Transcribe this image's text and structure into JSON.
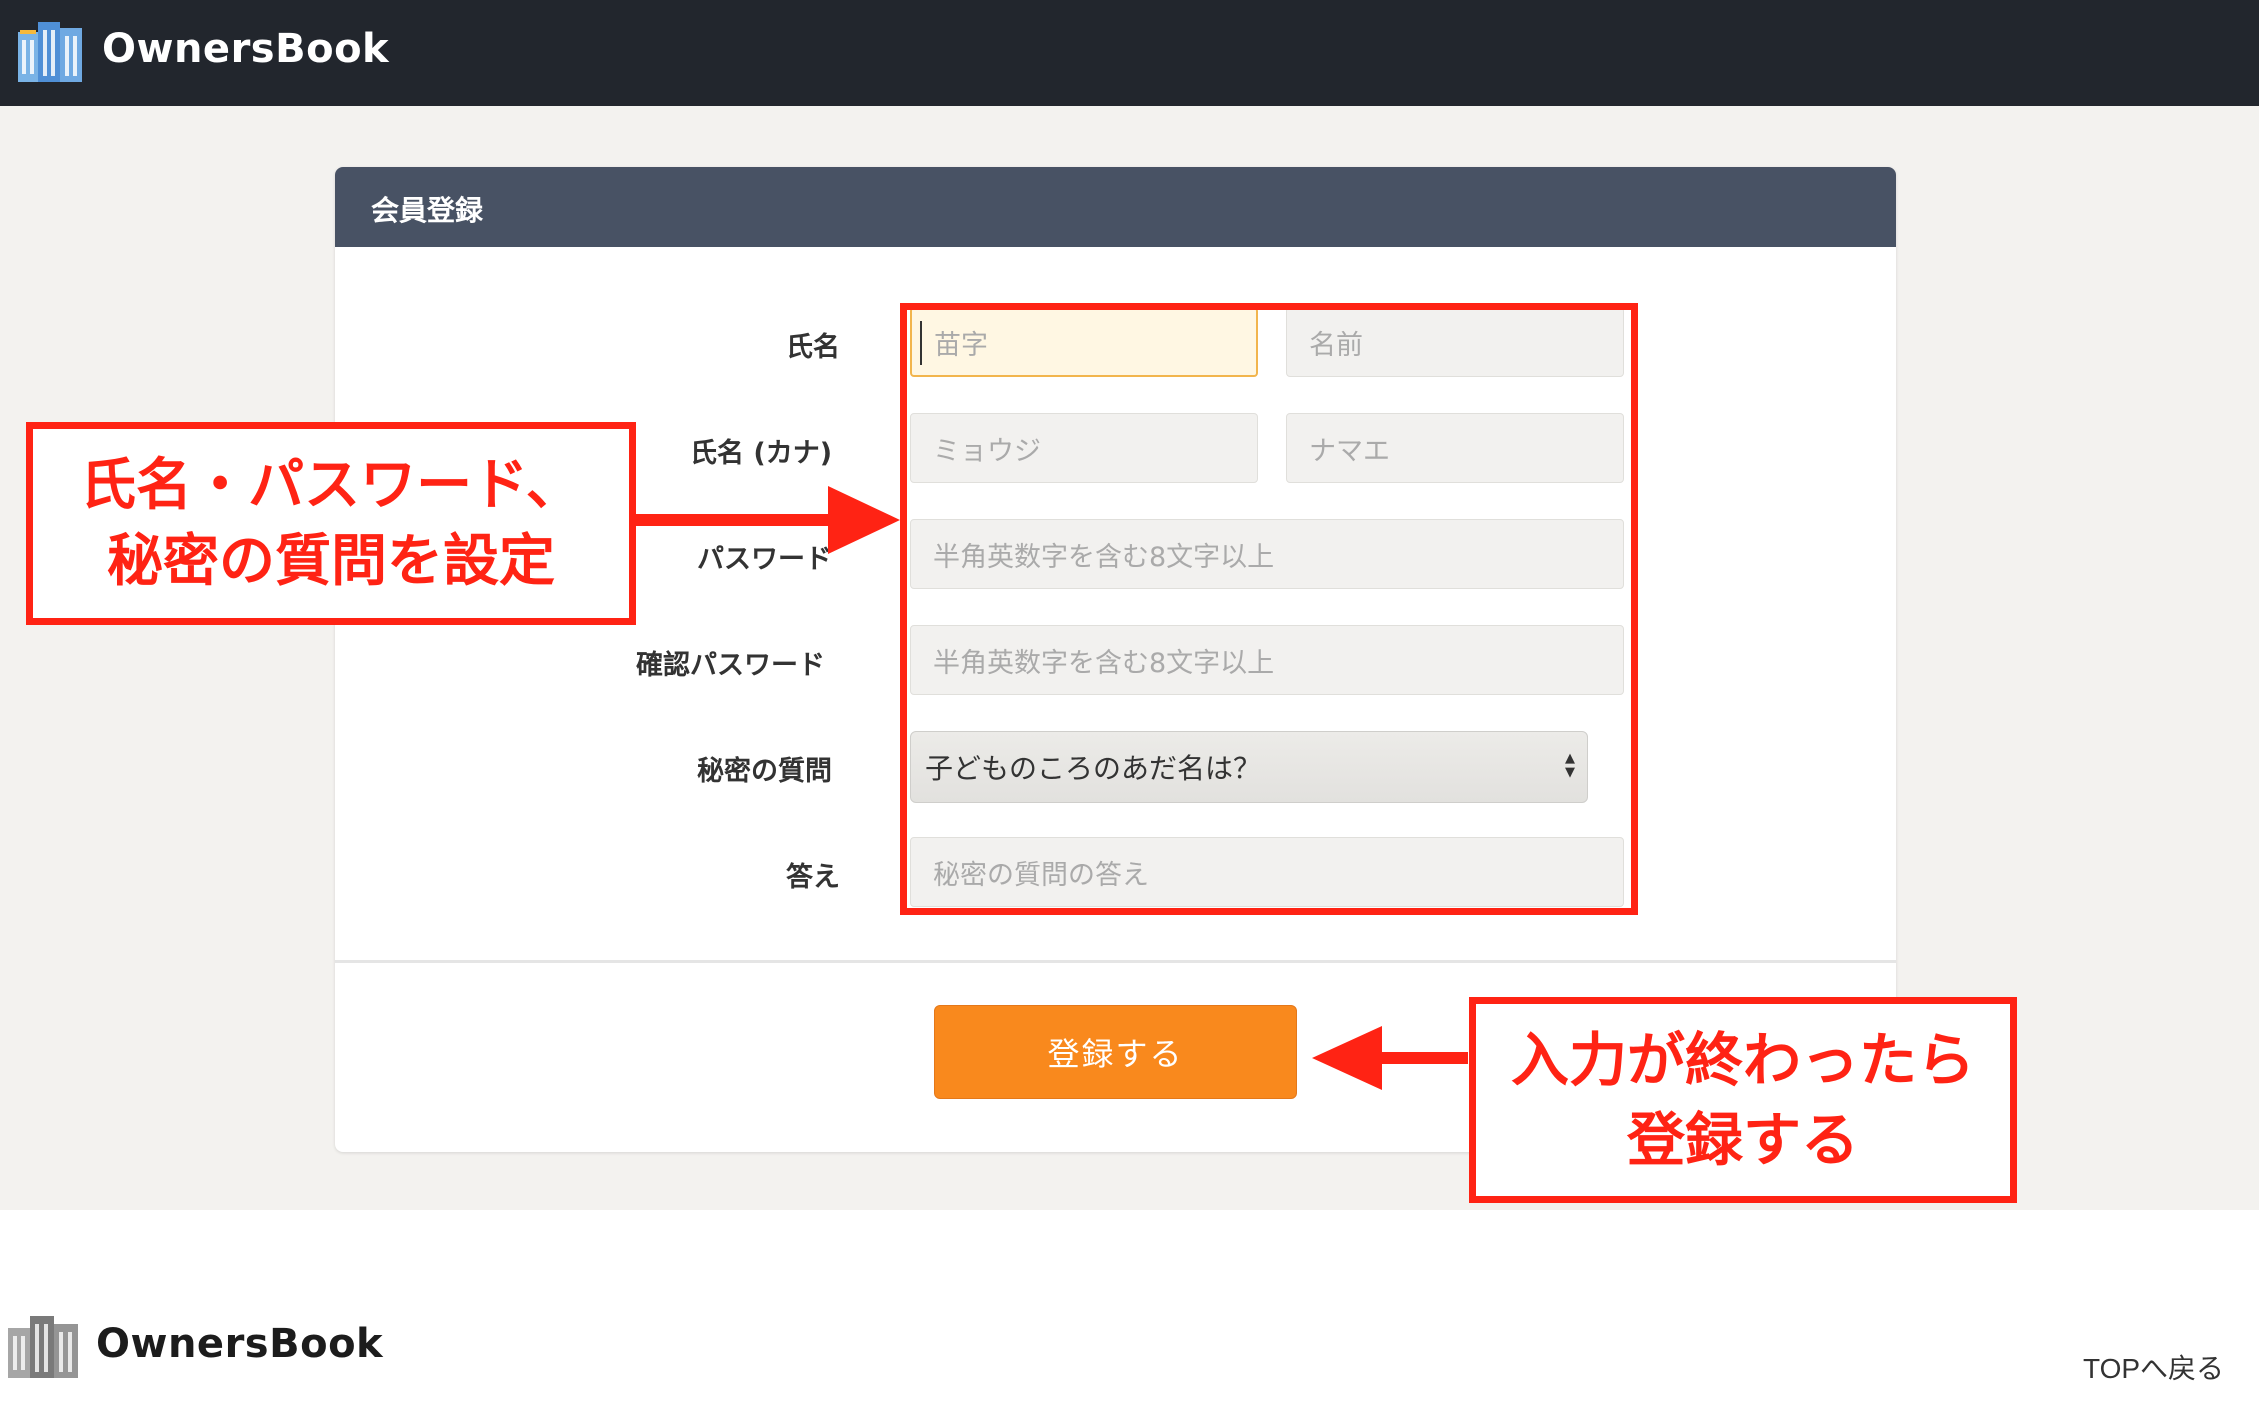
{
  "header": {
    "brand": "OwnersBook"
  },
  "form": {
    "title": "会員登録",
    "fields": {
      "name_label": "氏名",
      "last_name_placeholder": "苗字",
      "first_name_placeholder": "名前",
      "kana_label": "氏名 (カナ)",
      "last_kana_placeholder": "ミョウジ",
      "first_kana_placeholder": "ナマエ",
      "password_label": "パスワード",
      "password_placeholder": "半角英数字を含む8文字以上",
      "confirm_label": "確認パスワード",
      "confirm_placeholder": "半角英数字を含む8文字以上",
      "secret_label": "秘密の質問",
      "secret_selected": "子どものころのあだ名は？",
      "answer_label": "答え",
      "answer_placeholder": "秘密の質問の答え"
    },
    "submit_label": "登録する"
  },
  "annotations": {
    "callout1_line1": "氏名・パスワード、",
    "callout1_line2": "秘密の質問を設定",
    "callout2_line1": "入力が終わったら",
    "callout2_line2": "登録する",
    "highlight_color": "#ff2314"
  },
  "footer": {
    "brand": "OwnersBook",
    "top_link": "TOPへ戻る"
  },
  "colors": {
    "topbar": "#22262d",
    "panel_header": "#485264",
    "accent_button": "#f9891d",
    "background": "#f3f2ef"
  }
}
